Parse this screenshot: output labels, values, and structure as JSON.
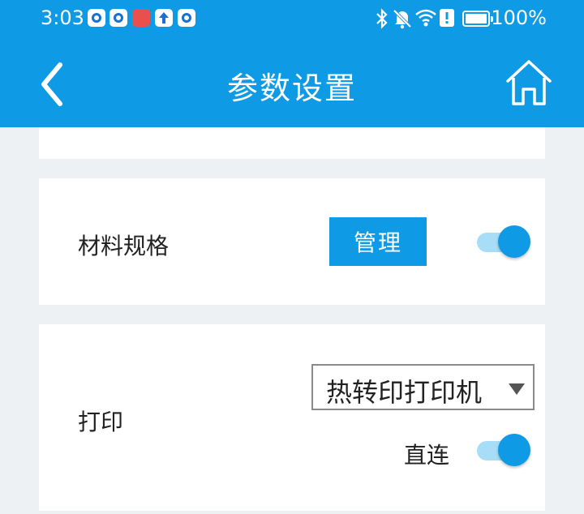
{
  "status_bar": {
    "time": "3:03",
    "battery": "100%"
  },
  "header": {
    "title": "参数设置"
  },
  "material": {
    "label": "材料规格",
    "manage_label": "管理",
    "enabled": true
  },
  "print": {
    "label": "打印",
    "printer_type": "热转印打印机",
    "direct_label": "直连",
    "direct_enabled": true
  },
  "colors": {
    "accent": "#0f9ae6",
    "background": "#eef1f4"
  }
}
